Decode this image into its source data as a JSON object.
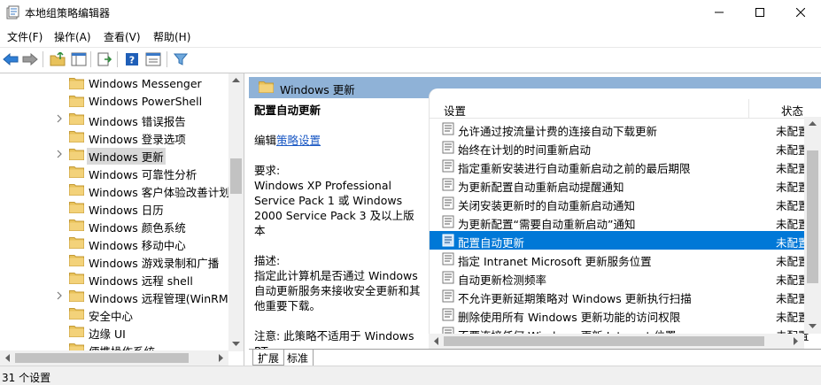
{
  "window": {
    "title": "本地组策略编辑器"
  },
  "menu": {
    "items": [
      {
        "label": "文件(F)"
      },
      {
        "label": "操作(A)"
      },
      {
        "label": "查看(V)"
      },
      {
        "label": "帮助(H)"
      }
    ]
  },
  "tree": {
    "items": [
      {
        "label": "Windows Messenger",
        "expandable": false
      },
      {
        "label": "Windows PowerShell",
        "expandable": false
      },
      {
        "label": "Windows 错误报告",
        "expandable": true
      },
      {
        "label": "Windows 登录选项",
        "expandable": false
      },
      {
        "label": "Windows 更新",
        "expandable": true,
        "selected": true
      },
      {
        "label": "Windows 可靠性分析",
        "expandable": false
      },
      {
        "label": "Windows 客户体验改善计划",
        "expandable": false
      },
      {
        "label": "Windows 日历",
        "expandable": false
      },
      {
        "label": "Windows 颜色系统",
        "expandable": false
      },
      {
        "label": "Windows 移动中心",
        "expandable": false
      },
      {
        "label": "Windows 游戏录制和广播",
        "expandable": false
      },
      {
        "label": "Windows 远程 shell",
        "expandable": false
      },
      {
        "label": "Windows 远程管理(WinRM)",
        "expandable": true
      },
      {
        "label": "安全中心",
        "expandable": false
      },
      {
        "label": "边缘 UI",
        "expandable": false
      },
      {
        "label": "便携操作系统",
        "expandable": false
      }
    ]
  },
  "detail": {
    "header_title": "Windows 更新",
    "policy_title": "配置自动更新",
    "edit_prefix": "编辑",
    "edit_link": "策略设置",
    "requirements_label": "要求:",
    "requirements_text": "Windows XP Professional Service Pack 1 或 Windows 2000 Service Pack 3 及以上版本",
    "description_label": "描述:",
    "description_text": "指定此计算机是否通过 Windows 自动更新服务来接收安全更新和其他重要下载。",
    "note_text": "注意: 此策略不适用于 Windows RT。"
  },
  "list": {
    "col_settings": "设置",
    "col_status": "状态",
    "rows": [
      {
        "label": "允许通过按流量计费的连接自动下载更新",
        "state": "未配置"
      },
      {
        "label": "始终在计划的时间重新启动",
        "state": "未配置"
      },
      {
        "label": "指定重新安装进行自动重新启动之前的最后期限",
        "state": "未配置"
      },
      {
        "label": "为更新配置自动重新启动提醒通知",
        "state": "未配置"
      },
      {
        "label": "关闭安装更新时的自动重新启动通知",
        "state": "未配置"
      },
      {
        "label": "为更新配置“需要自动重新启动”通知",
        "state": "未配置"
      },
      {
        "label": "配置自动更新",
        "state": "未配置",
        "selected": true
      },
      {
        "label": "指定 Intranet Microsoft 更新服务位置",
        "state": "未配置"
      },
      {
        "label": "自动更新检测频率",
        "state": "未配置"
      },
      {
        "label": "不允许更新延期策略对 Windows 更新执行扫描",
        "state": "未配置"
      },
      {
        "label": "删除使用所有 Windows 更新功能的访问权限",
        "state": "未配置"
      },
      {
        "label": "不要连接任何 Windows 更新 Internet 位置",
        "state": "未配置"
      }
    ]
  },
  "tabs": {
    "extended": "扩展",
    "standard": "标准"
  },
  "status": {
    "text": "31 个设置"
  },
  "colors": {
    "selection_blue": "#0078d7",
    "header_blue": "#8fb2d7",
    "folder_yellow": "#e8c25b",
    "link_blue": "#1b59c4"
  }
}
